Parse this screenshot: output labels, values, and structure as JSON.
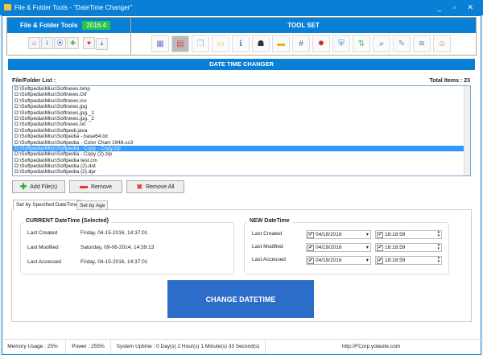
{
  "window": {
    "title": "File & Folder Tools - \"DateTime Changer\"",
    "controls": "_ ▫ ✕"
  },
  "brand": {
    "name": "File & Folder Tools",
    "version": "2016.4",
    "buttons": [
      {
        "icon": "home-icon",
        "g": "⌂",
        "c": "#c33"
      },
      {
        "icon": "info-icon",
        "g": "i",
        "c": "#2255cc"
      },
      {
        "icon": "broadcast-icon",
        "g": "⦿",
        "c": "#2255cc"
      },
      {
        "icon": "health-icon",
        "g": "✚",
        "c": "#4a4"
      },
      {
        "icon": "heart-icon",
        "g": "♥",
        "c": "#d22"
      },
      {
        "icon": "download-icon",
        "g": "⤓",
        "c": "#2255cc"
      }
    ]
  },
  "toolset": {
    "title": "TOOL SET",
    "tools": [
      {
        "icon": "file-compare-icon",
        "g": "▦",
        "c": "#8a6fc0"
      },
      {
        "icon": "calendar-icon",
        "g": "▤",
        "c": "#d44"
      },
      {
        "icon": "copy-icon",
        "g": "❐",
        "c": "#9bc"
      },
      {
        "icon": "notes-icon",
        "g": "▭",
        "c": "#e8c860"
      },
      {
        "icon": "info-circle-icon",
        "g": "ℹ",
        "c": "#58c"
      },
      {
        "icon": "bug-icon",
        "g": "☗",
        "c": "#333"
      },
      {
        "icon": "folder-icon",
        "g": "▬",
        "c": "#e9b820"
      },
      {
        "icon": "hash-icon",
        "g": "#",
        "c": "#666"
      },
      {
        "icon": "shred-icon",
        "g": "✹",
        "c": "#c22"
      },
      {
        "icon": "shield-icon",
        "g": "⛨",
        "c": "#2a8ad0"
      },
      {
        "icon": "transfer-icon",
        "g": "⇅",
        "c": "#6b6"
      },
      {
        "icon": "search-icon",
        "g": "⌕",
        "c": "#2255cc"
      },
      {
        "icon": "pencil-icon",
        "g": "✎",
        "c": "#a87"
      },
      {
        "icon": "document-icon",
        "g": "≋",
        "c": "#58c"
      },
      {
        "icon": "user-lock-icon",
        "g": "☺",
        "c": "#c8882c"
      }
    ]
  },
  "section": {
    "title": "DATE TIME CHANGER"
  },
  "filelist": {
    "label": "File/Folder List :",
    "total": "Total Items : 23",
    "selected_index": 10,
    "items": [
      "D:\\Softpedia\\Misc\\Softnews.bmp",
      "D:\\Softpedia\\Misc\\Softnews.Gif",
      "D:\\Softpedia\\Misc\\Softnews.ico",
      "D:\\Softpedia\\Misc\\Softnews.jpg",
      "D:\\Softpedia\\Misc\\Softnews.jpg._1",
      "D:\\Softpedia\\Misc\\Softnews.jpg._2",
      "D:\\Softpedia\\Misc\\Softnews.txt",
      "D:\\Softpedia\\Misc\\Softpedi.java",
      "D:\\Softpedia\\Misc\\Softpedia - base64.txt",
      "D:\\Softpedia\\Misc\\Softpedia - Color Chart 1948.ss3",
      "D:\\Softpedia\\Misc\\Softpedia - Copy - Copy.zip",
      "D:\\Softpedia\\Misc\\Softpedia - Copy (2).zip",
      "D:\\Softpedia\\Misc\\Softpedia  test.cm",
      "D:\\Softpedia\\Misc\\Softpedia (2).dot",
      "D:\\Softpedia\\Misc\\Softpedia (2).dpr"
    ]
  },
  "actions": {
    "add": "Add File(s)",
    "remove": "Remove",
    "remove_all": "Remove All"
  },
  "tabs": [
    "Set by Specified DateTime",
    "Set by Age"
  ],
  "current": {
    "title": "CURRENT DateTime (Selected)",
    "rows": [
      {
        "label": "Last Created",
        "value": "Friday, 04-15-2016, 14:37:01"
      },
      {
        "label": "Last Modified",
        "value": "Saturday, 09-06-2014, 14:39:13"
      },
      {
        "label": "Last Accessed",
        "value": "Friday, 04-15-2016, 14:37:01"
      }
    ]
  },
  "new": {
    "title": "NEW DateTime",
    "rows": [
      {
        "label": "Last Created",
        "date": "04/19/2016",
        "time": "18:18:59"
      },
      {
        "label": "Last Modified",
        "date": "04/19/2016",
        "time": "18:18:59"
      },
      {
        "label": "Last Accessed",
        "date": "04/19/2016",
        "time": "18:18:59"
      }
    ]
  },
  "change_button": "CHANGE DATETIME",
  "status": {
    "memory": "Memory Usage : 25%",
    "power": "Power : 255%",
    "uptime": "System Uptime : 0 Day(s) 2 Hour(s) 1 Minute(s) 33 Second(s)",
    "url": "http://FCorp.yolasite.com"
  }
}
